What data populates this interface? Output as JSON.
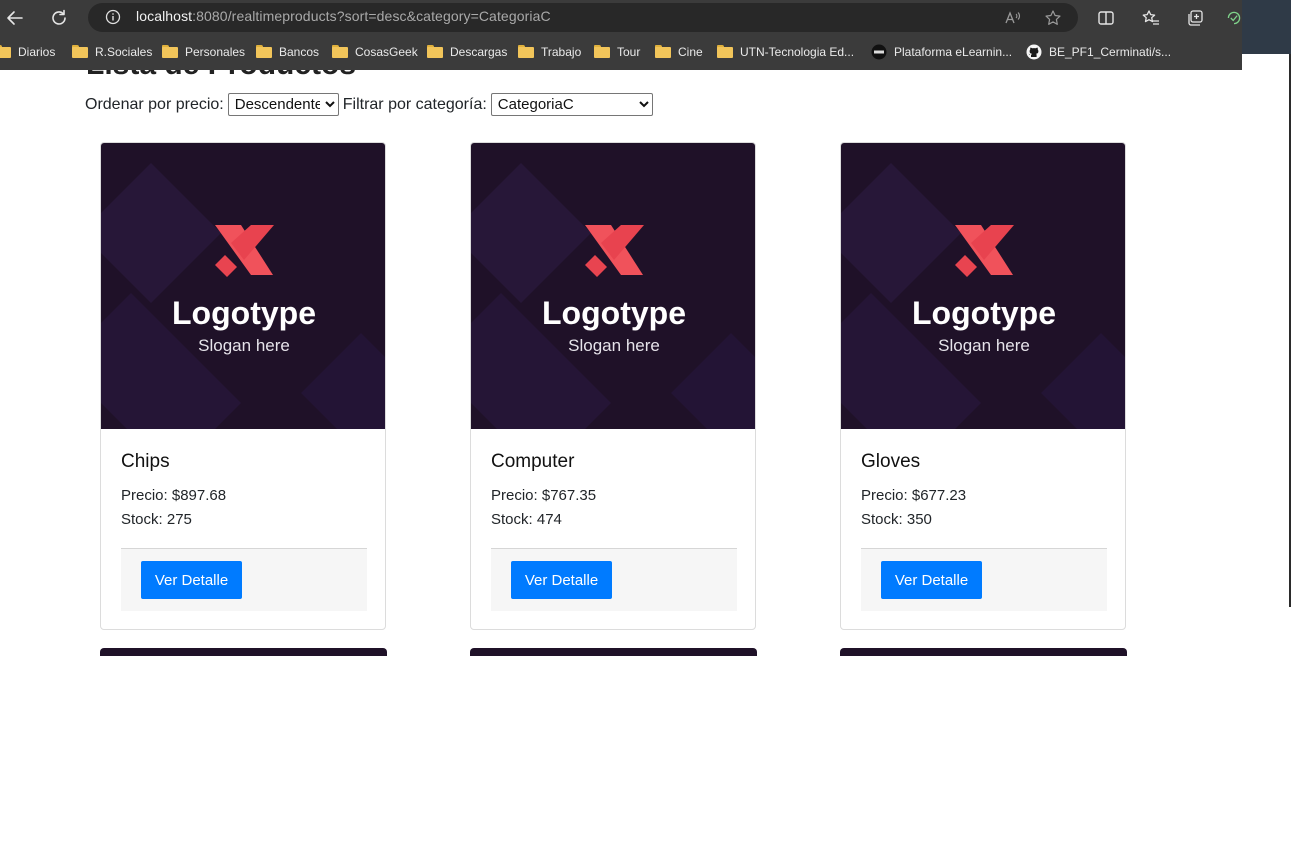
{
  "browser": {
    "url_host": "localhost",
    "url_rest": ":8080/realtimeproducts?sort=desc&category=CategoriaC",
    "bookmarks": [
      {
        "label": "Diarios",
        "icon": "folder-icon"
      },
      {
        "label": "R.Sociales",
        "icon": "folder-icon"
      },
      {
        "label": "Personales",
        "icon": "folder-icon"
      },
      {
        "label": "Bancos",
        "icon": "folder-icon"
      },
      {
        "label": "CosasGeek",
        "icon": "folder-icon"
      },
      {
        "label": "Descargas",
        "icon": "folder-icon"
      },
      {
        "label": "Trabajo",
        "icon": "folder-icon"
      },
      {
        "label": "Tour",
        "icon": "folder-icon"
      },
      {
        "label": "Cine",
        "icon": "folder-icon"
      },
      {
        "label": "UTN-Tecnologia Ed...",
        "icon": "folder-icon"
      },
      {
        "label": "Plataforma eLearnin...",
        "icon": "coder-logo-icon"
      },
      {
        "label": "BE_PF1_Cerminati/s...",
        "icon": "github-icon"
      }
    ]
  },
  "page": {
    "title": "Lista de Productos",
    "sort_label": "Ordenar por precio:",
    "sort_selected": "Descendente",
    "category_label": "Filtrar por categoría:",
    "category_selected": "CategoriaC"
  },
  "products": [
    {
      "name": "Chips",
      "price": "Precio: $897.68",
      "stock": "Stock: 275",
      "button": "Ver Detalle",
      "logo_title": "Logotype",
      "logo_slogan": "Slogan here"
    },
    {
      "name": "Computer",
      "price": "Precio: $767.35",
      "stock": "Stock: 474",
      "button": "Ver Detalle",
      "logo_title": "Logotype",
      "logo_slogan": "Slogan here"
    },
    {
      "name": "Gloves",
      "price": "Precio: $677.23",
      "stock": "Stock: 350",
      "button": "Ver Detalle",
      "logo_title": "Logotype",
      "logo_slogan": "Slogan here"
    }
  ],
  "colors": {
    "logo_bg": "#1f1128",
    "logo_accent": "#f0525b",
    "button": "#007bff"
  }
}
